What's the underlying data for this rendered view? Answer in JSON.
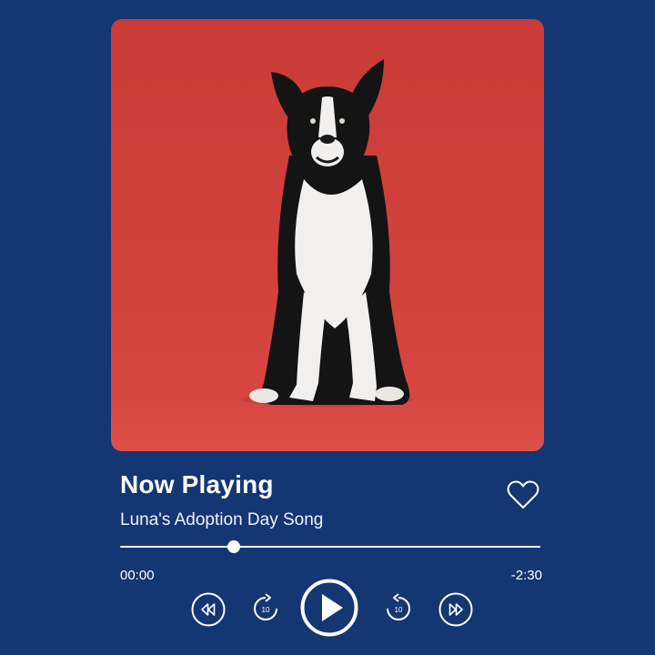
{
  "player": {
    "heading": "Now Playing",
    "song_title": "Luna's Adoption Day Song",
    "elapsed": "00:00",
    "remaining": "-2:30",
    "progress_fraction": 0.27,
    "liked": false
  },
  "controls": {
    "skip_back_seconds": "10",
    "skip_forward_seconds": "10",
    "icons": [
      "rewind-icon",
      "replay-10-icon",
      "play-icon",
      "forward-10-icon",
      "fast-forward-icon"
    ]
  },
  "colors": {
    "background": "#143673",
    "artwork_backdrop": "#d4443c",
    "foreground": "#ffffff"
  }
}
